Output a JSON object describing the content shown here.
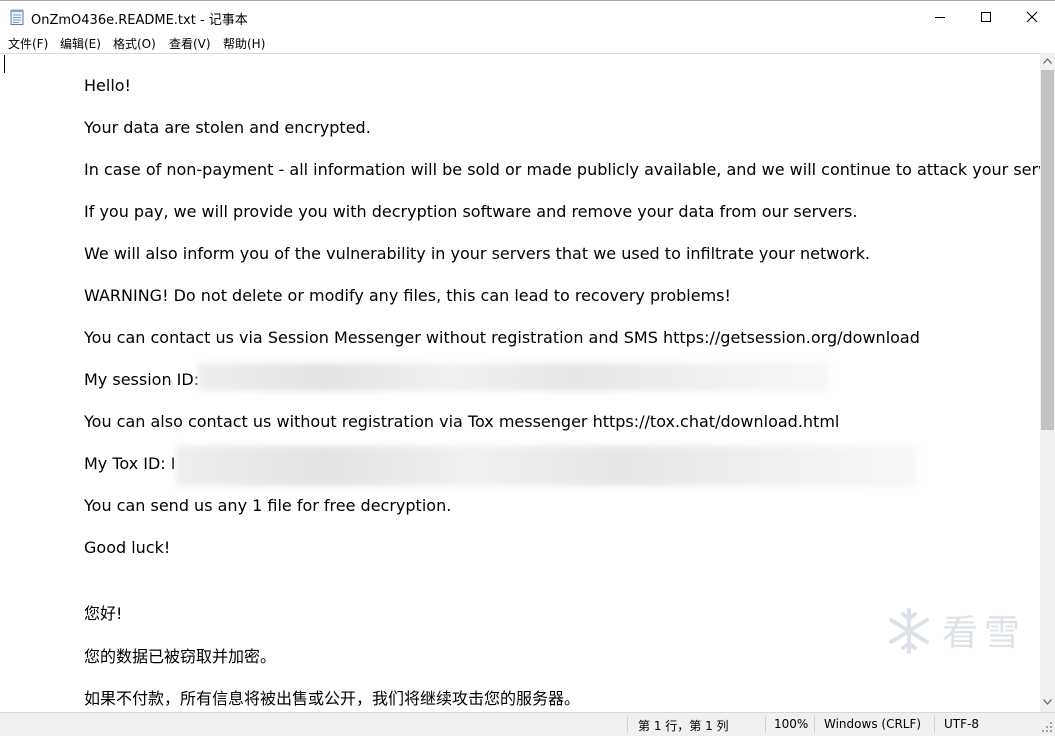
{
  "window": {
    "title": "OnZmO436e.README.txt - 记事本",
    "icon": "notepad-icon",
    "controls": {
      "minimize": "minimize-icon",
      "maximize": "maximize-icon",
      "close": "close-icon"
    }
  },
  "menu": [
    "文件(F)",
    "编辑(E)",
    "格式(O)",
    "查看(V)",
    "帮助(H)"
  ],
  "document": {
    "lines": [
      "Hello!",
      "Your data are stolen and encrypted.",
      "In case of non-payment - all information will be sold or made publicly available, and we will continue to attack your servers.",
      "If you pay, we will provide you with decryption software and remove your data from our servers.",
      "We will also inform you of the vulnerability in your servers that we used to infiltrate your network.",
      "WARNING! Do not delete or modify any files, this can lead to recovery problems!",
      "You can contact us via Session Messenger without registration and SMS https://getsession.org/download",
      "My session ID:",
      "You can also contact us without registration via Tox messenger  https://tox.chat/download.html",
      "My Tox ID: I",
      "You can send us any 1 file for free decryption.",
      "Good luck!",
      "您好!",
      "您的数据已被窃取并加密。",
      "如果不付款，所有信息将被出售或公开，我们将继续攻击您的服务器。"
    ]
  },
  "watermark": {
    "text": "看雪",
    "icon": "snowflake-icon"
  },
  "status": {
    "position": "第 1 行，第 1 列",
    "zoom": "100%",
    "line_ending": "Windows (CRLF)",
    "encoding": "UTF-8"
  },
  "colors": {
    "scroll_thumb": "#c2c2c2",
    "status_bg": "#f0f0f0"
  }
}
